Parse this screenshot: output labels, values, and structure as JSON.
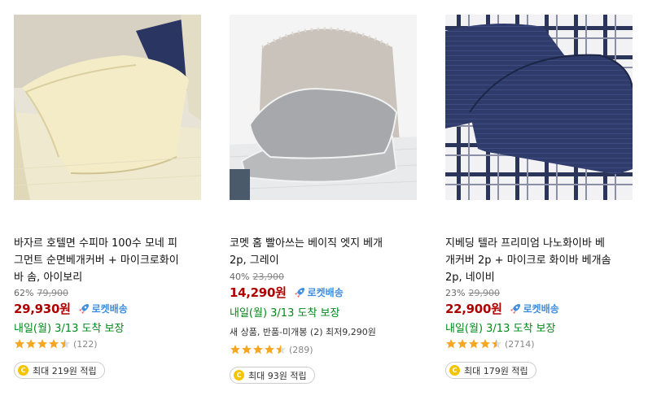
{
  "products": [
    {
      "title_lines": [
        "바자르 호텔면 수피마 100수 모네 피",
        "그먼트 순면베개커버 + 마이크로화이",
        "바 솜, 아이보리"
      ],
      "discount": "62%",
      "original_price": "79,900",
      "price": "29,930원",
      "rocket_label": "로켓배송",
      "delivery": "내일(월) 3/13 도착 보장",
      "rating": 4.5,
      "review_count": "(122)",
      "points": "최대 219원 적립",
      "image": "ivory-pillow-photo"
    },
    {
      "title_lines": [
        "코멧 홈 빨아쓰는 베이직 엣지 베개",
        "2p, 그레이"
      ],
      "discount": "40%",
      "original_price": "23,900",
      "price": "14,290원",
      "rocket_label": "로켓배송",
      "delivery": "내일(월) 3/13 도착 보장",
      "extra": "새 상품, 반품-미개봉 (2) 최저9,290원",
      "rating": 4.5,
      "review_count": "(289)",
      "points": "최대 93원 적립",
      "image": "gray-pillow-photo"
    },
    {
      "title_lines": [
        "지베딩 텔라 프리미엄 나노화이바 베",
        "개커버 2p + 마이크로 화이바 베개솜",
        "2p, 네이비"
      ],
      "discount": "23%",
      "original_price": "29,900",
      "price": "22,900원",
      "rocket_label": "로켓배송",
      "delivery": "내일(월) 3/13 도착 보장",
      "rating": 4.5,
      "review_count": "(2714)",
      "points": "최대 179원 적립",
      "image": "navy-pillow-photo"
    }
  ],
  "colors": {
    "price": "#ae0000",
    "rocket": "#3f8dde",
    "delivery": "#00891a",
    "star": "#f5a623",
    "coin": "#f5c400"
  },
  "icons": {
    "rocket": "rocket-icon",
    "star": "star-icon",
    "coin": "coin-icon"
  },
  "coin_symbol": "C"
}
